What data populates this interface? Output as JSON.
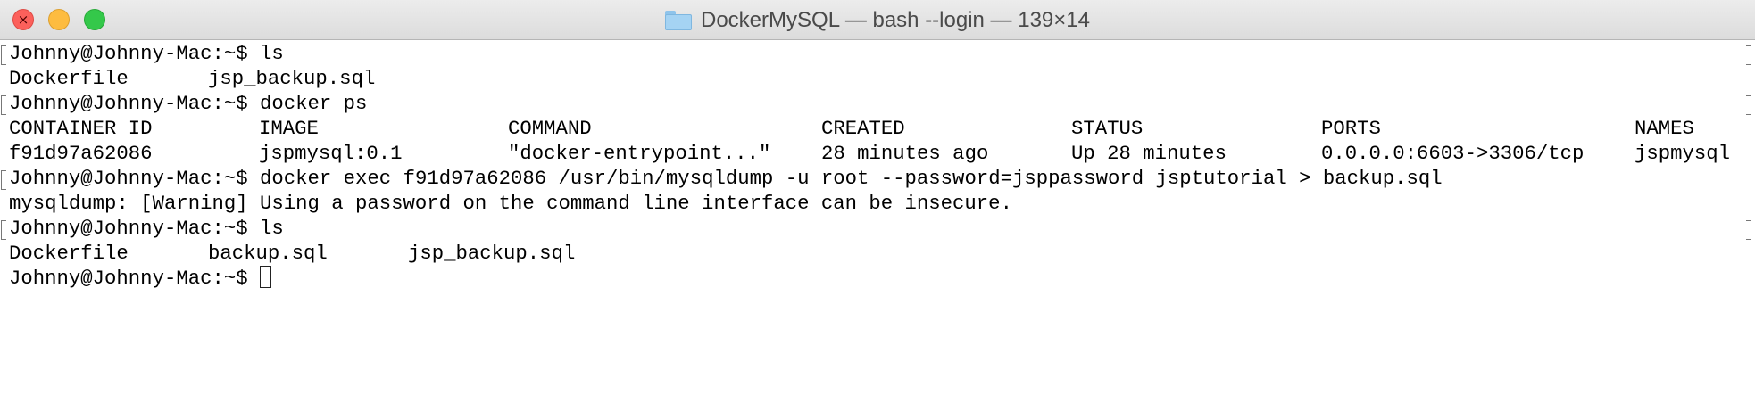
{
  "window": {
    "title": "DockerMySQL — bash --login — 139×14",
    "icons": {
      "close": "close-icon",
      "minimize": "minimize-icon",
      "maximize": "maximize-icon",
      "folder": "folder-icon"
    },
    "colors": {
      "close": "#fc605b",
      "minimize": "#fdbc40",
      "maximize": "#34c84a",
      "folder": "#a5d3f3"
    }
  },
  "terminal": {
    "prompt": "Johnny@Johnny-Mac:~$ ",
    "commands": {
      "ls1": "ls",
      "docker_ps": "docker ps",
      "exec": "docker exec f91d97a62086 /usr/bin/mysqldump -u root --password=jsppassword jsptutorial > backup.sql",
      "ls2": "ls"
    },
    "ls1_output": [
      "Dockerfile",
      "jsp_backup.sql"
    ],
    "ps_headers": [
      "CONTAINER ID",
      "IMAGE",
      "COMMAND",
      "CREATED",
      "STATUS",
      "PORTS",
      "NAMES"
    ],
    "ps_row": [
      "f91d97a62086",
      "jspmysql:0.1",
      "\"docker-entrypoint...\"",
      "28 minutes ago",
      "Up 28 minutes",
      "0.0.0.0:6603->3306/tcp",
      "jspmysql"
    ],
    "warning": "mysqldump: [Warning] Using a password on the command line interface can be insecure.",
    "ls2_output": [
      "Dockerfile",
      "backup.sql",
      "jsp_backup.sql"
    ]
  }
}
